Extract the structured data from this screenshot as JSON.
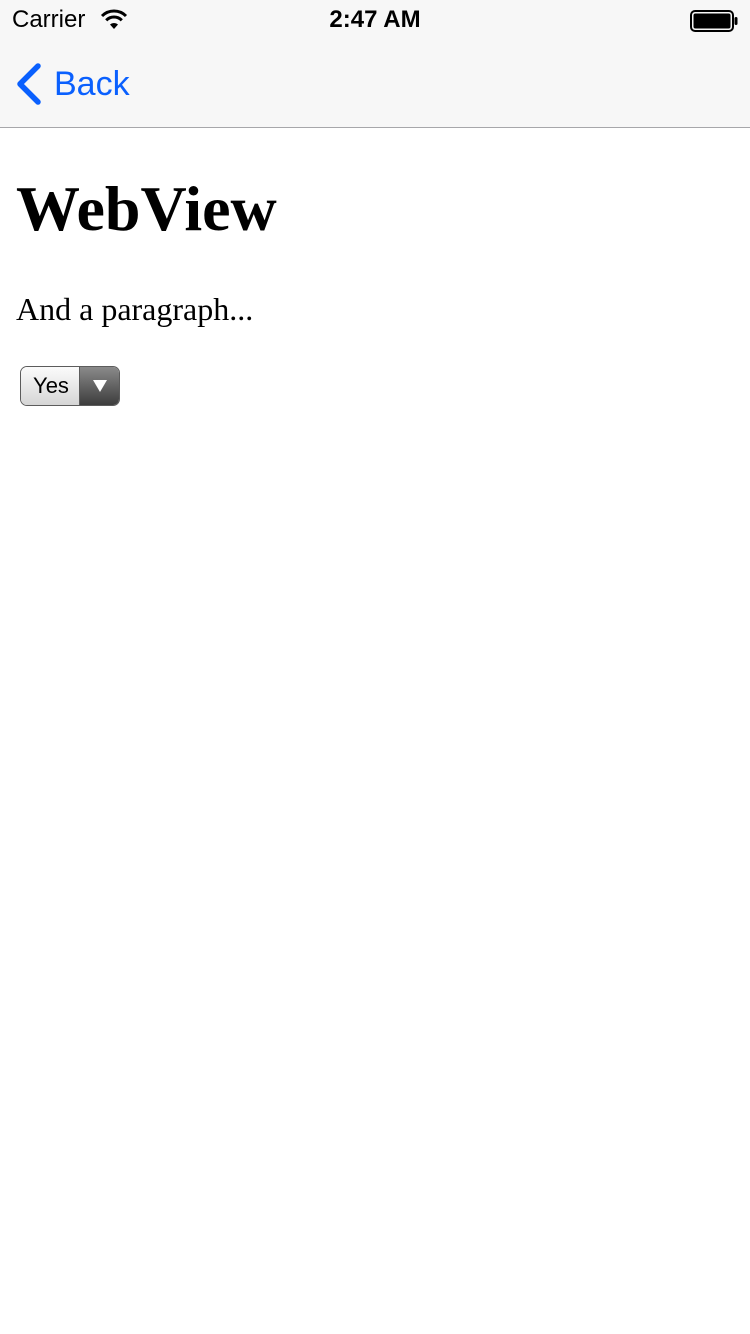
{
  "status_bar": {
    "carrier": "Carrier",
    "time": "2:47 AM",
    "wifi_icon": "wifi-icon",
    "battery_icon": "battery-icon"
  },
  "nav": {
    "back_label": "Back",
    "back_icon": "chevron-left-icon",
    "accent_color": "#0a60fe"
  },
  "content": {
    "title": "WebView",
    "paragraph": "And a paragraph...",
    "select": {
      "selected": "Yes",
      "arrow_icon": "triangle-down-icon"
    }
  }
}
